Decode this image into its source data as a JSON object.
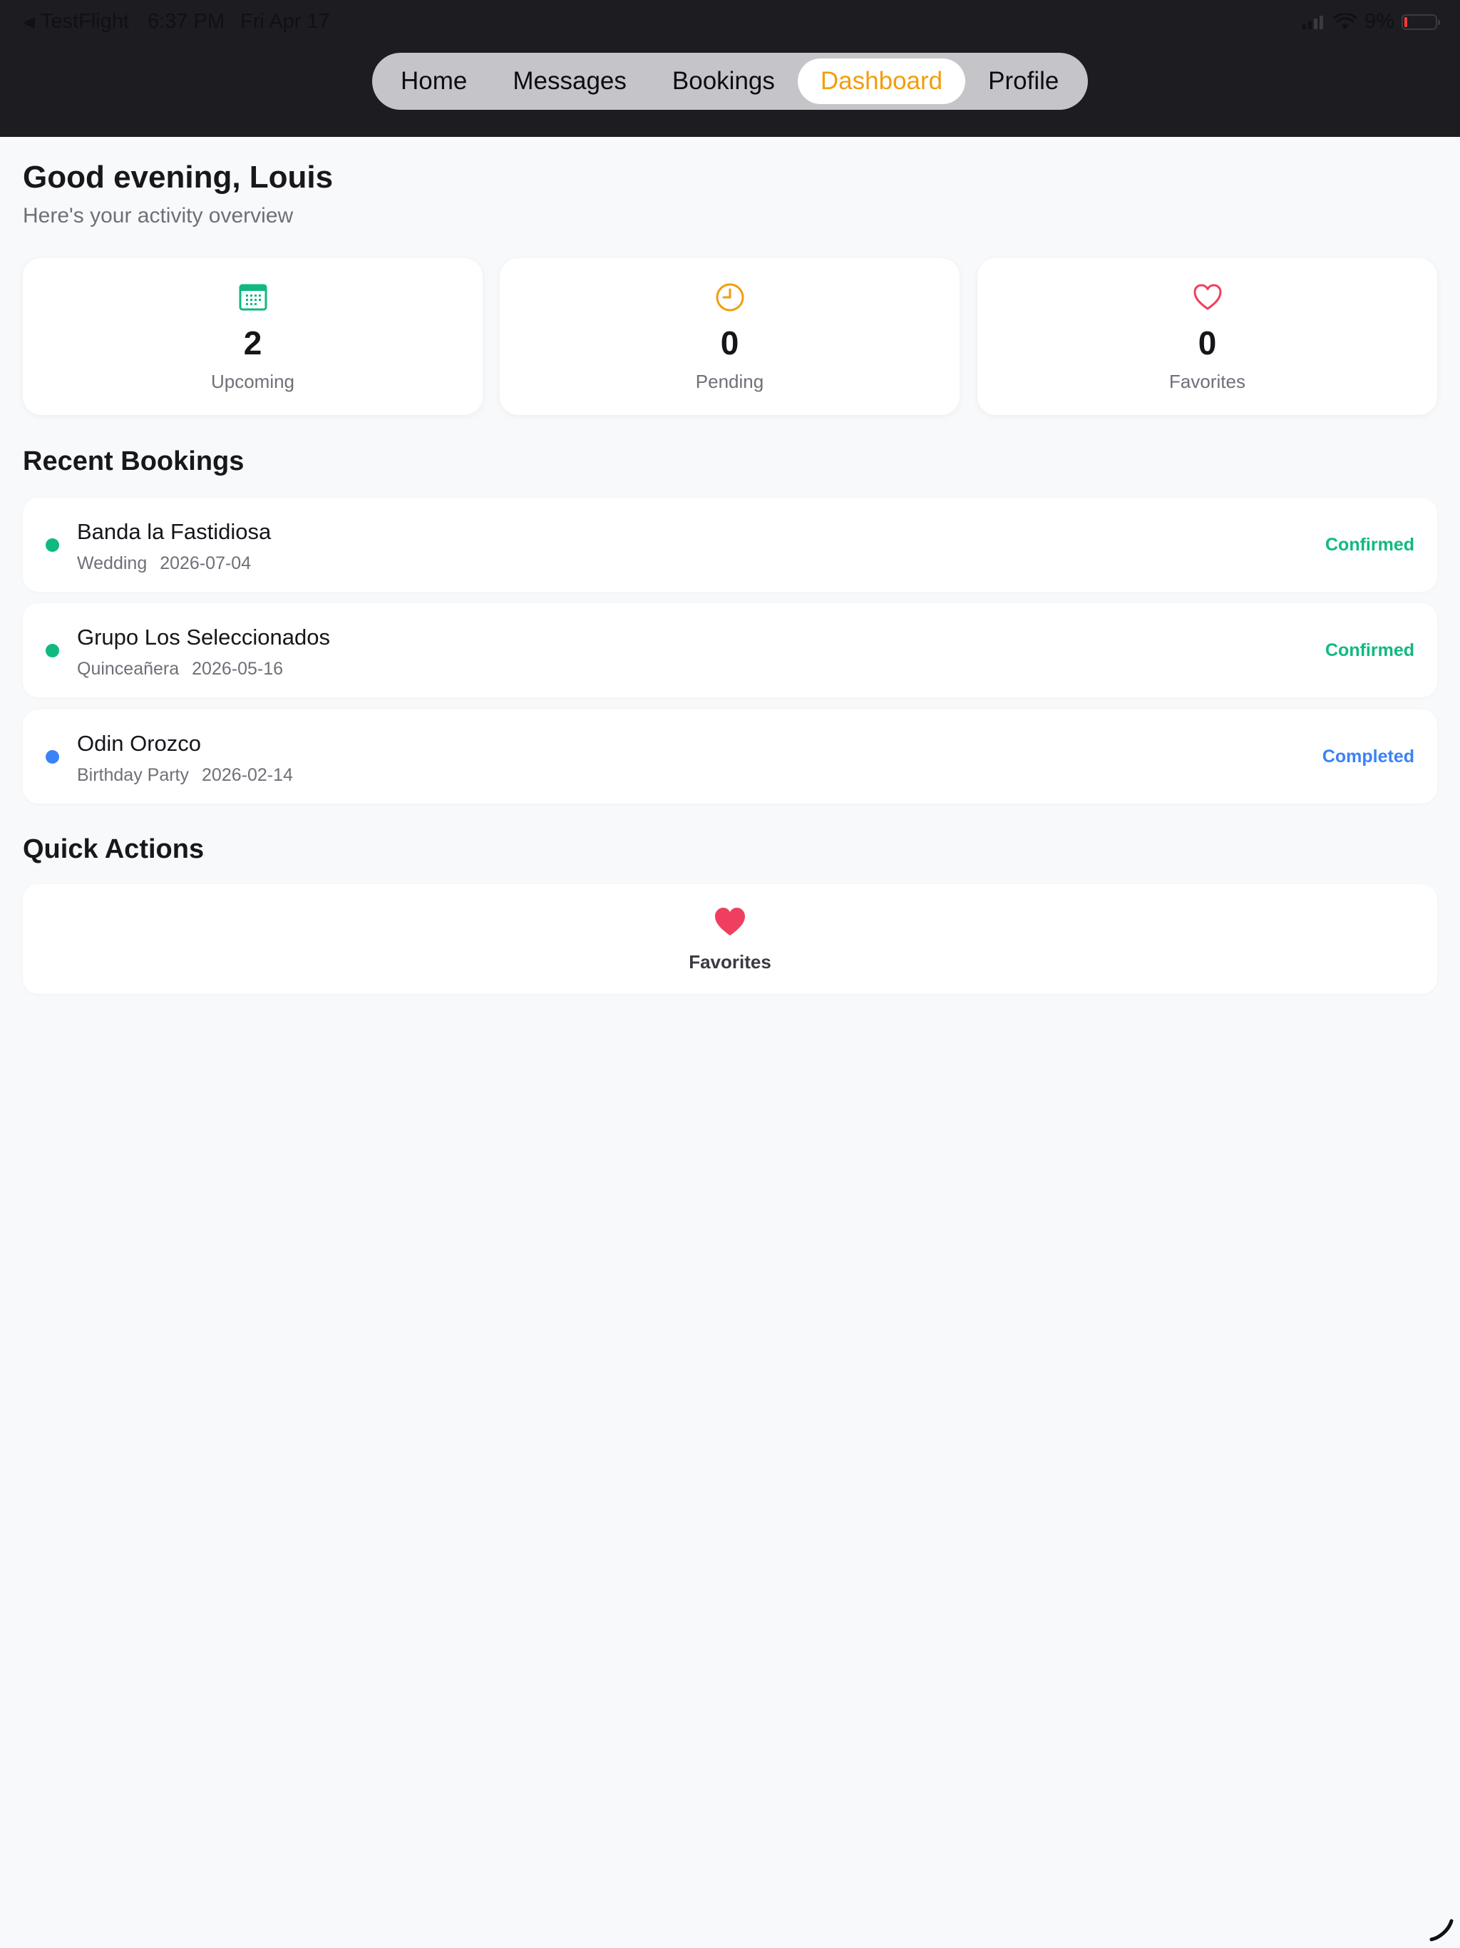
{
  "status_bar": {
    "back_arrow": "◀",
    "back_app": "TestFlight",
    "time": "6:37 PM",
    "date": "Fri Apr 17",
    "battery_percent": "9%",
    "battery_level": 0.09
  },
  "nav": {
    "tabs": [
      {
        "label": "Home",
        "active": false
      },
      {
        "label": "Messages",
        "active": false
      },
      {
        "label": "Bookings",
        "active": false
      },
      {
        "label": "Dashboard",
        "active": true
      },
      {
        "label": "Profile",
        "active": false
      }
    ]
  },
  "header": {
    "greeting": "Good evening, Louis",
    "subtitle": "Here's your activity overview"
  },
  "stats": [
    {
      "icon": "calendar-icon",
      "value": "2",
      "label": "Upcoming",
      "color": "#10b981"
    },
    {
      "icon": "clock-icon",
      "value": "0",
      "label": "Pending",
      "color": "#f29d0c"
    },
    {
      "icon": "heart-outline-icon",
      "value": "0",
      "label": "Favorites",
      "color": "#ef3f5e"
    }
  ],
  "recent_bookings": {
    "title": "Recent Bookings",
    "items": [
      {
        "name": "Banda la Fastidiosa",
        "event": "Wedding",
        "date": "2026-07-04",
        "status": "Confirmed",
        "status_color": "#10b981"
      },
      {
        "name": "Grupo Los Seleccionados",
        "event": "Quinceañera",
        "date": "2026-05-16",
        "status": "Confirmed",
        "status_color": "#10b981"
      },
      {
        "name": "Odin Orozco",
        "event": "Birthday Party",
        "date": "2026-02-14",
        "status": "Completed",
        "status_color": "#3b82f6"
      }
    ]
  },
  "quick_actions": {
    "title": "Quick Actions",
    "items": [
      {
        "icon": "heart-filled-icon",
        "label": "Favorites",
        "color": "#ef3f5e"
      }
    ]
  },
  "colors": {
    "accent": "#f29d0c",
    "header_bg": "#1c1c21",
    "page_bg": "#f8f9fb"
  }
}
